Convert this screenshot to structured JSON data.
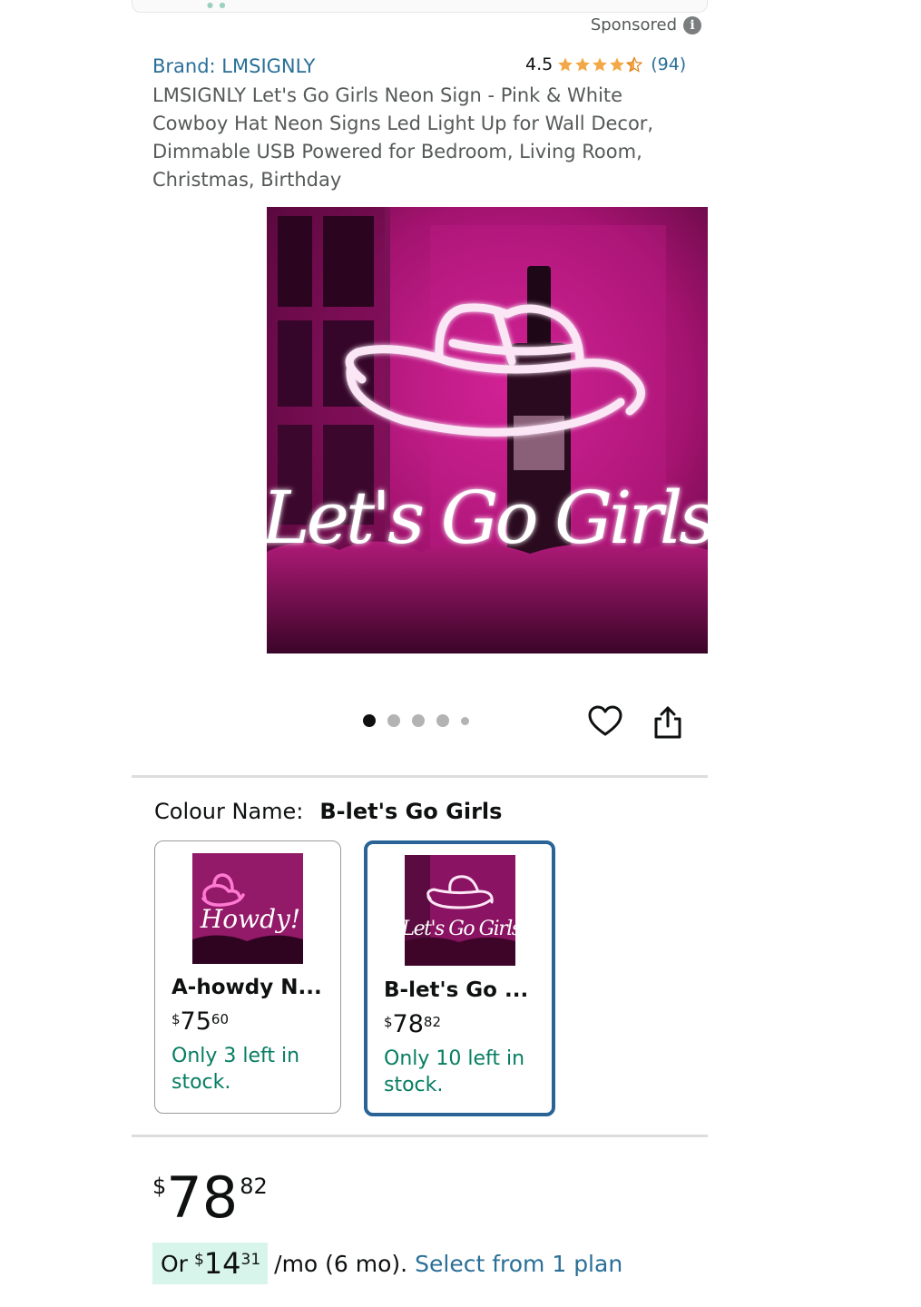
{
  "sponsored": {
    "label": "Sponsored",
    "icon": "info-icon"
  },
  "product": {
    "brand": "Brand: LMSIGNLY",
    "rating_value": "4.5",
    "rating_count": "(94)",
    "title": "LMSIGNLY Let's Go Girls Neon Sign - Pink & White Cowboy Hat Neon Signs Led Light Up for Wall Decor, Dimmable USB Powered for Bedroom, Living Room, Christmas, Birthday",
    "image_sign_text": "Let's Go Girls"
  },
  "carousel": {
    "total": 5,
    "active_index": 0
  },
  "actions": {
    "wishlist_icon": "heart-icon",
    "share_icon": "share-icon"
  },
  "colour": {
    "label": "Colour Name:",
    "selected": "B-let's Go Girls",
    "options": [
      {
        "name": "A-howdy N...",
        "price_symbol": "$",
        "price_whole": "75",
        "price_fraction": "60",
        "stock": "Only 3 left in stock.",
        "thumb_text": "Howdy!",
        "selected": false
      },
      {
        "name": "B-let's Go ...",
        "price_symbol": "$",
        "price_whole": "78",
        "price_fraction": "82",
        "stock": "Only 10 left in stock.",
        "thumb_text": "Let's Go Girls",
        "selected": true
      }
    ]
  },
  "price": {
    "symbol": "$",
    "whole": "78",
    "fraction": "82"
  },
  "installment": {
    "prefix": "Or",
    "symbol": "$",
    "whole": "14",
    "fraction": "31",
    "terms": "/mo (6 mo).",
    "link": "Select from 1 plan"
  },
  "colors": {
    "link": "#2a6f97",
    "stock": "#067d62",
    "star": "#f3a847",
    "selected_border": "#2a6496",
    "installment_bg": "#d7f5ea"
  }
}
